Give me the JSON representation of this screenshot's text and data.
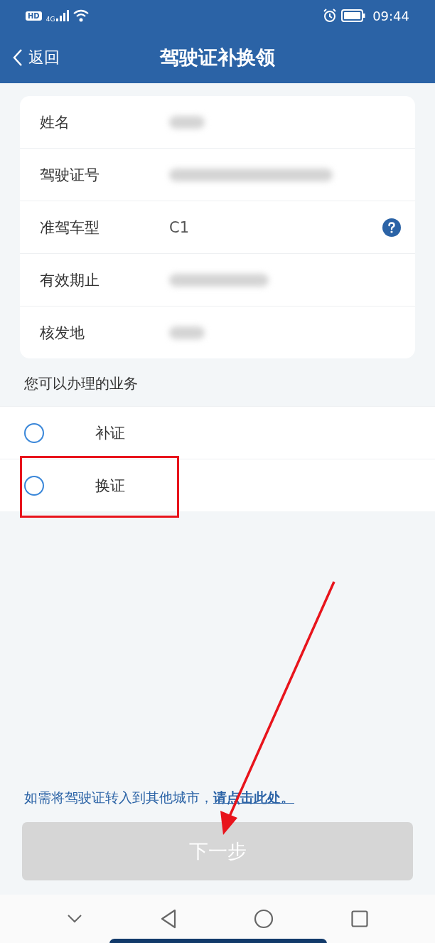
{
  "status_bar": {
    "hd": "HD",
    "network": "4G",
    "time": "09:44"
  },
  "header": {
    "back": "返回",
    "title": "驾驶证补换领"
  },
  "info_rows": [
    {
      "label": "姓名",
      "kind": "redacted",
      "help": false
    },
    {
      "label": "驾驶证号",
      "kind": "redacted",
      "help": false
    },
    {
      "label": "准驾车型",
      "kind": "text",
      "value": "C1",
      "help": true
    },
    {
      "label": "有效期止",
      "kind": "redacted",
      "help": false
    },
    {
      "label": "核发地",
      "kind": "redacted",
      "help": false
    }
  ],
  "section_title": "您可以办理的业务",
  "options": [
    {
      "label": "补证",
      "selected": false,
      "highlighted": false
    },
    {
      "label": "换证",
      "selected": false,
      "highlighted": true
    }
  ],
  "transfer_note": {
    "text": "如需将驾驶证转入到其他城市，",
    "link": "请点击此处。"
  },
  "next_button": {
    "label": "下一步",
    "disabled": true
  }
}
